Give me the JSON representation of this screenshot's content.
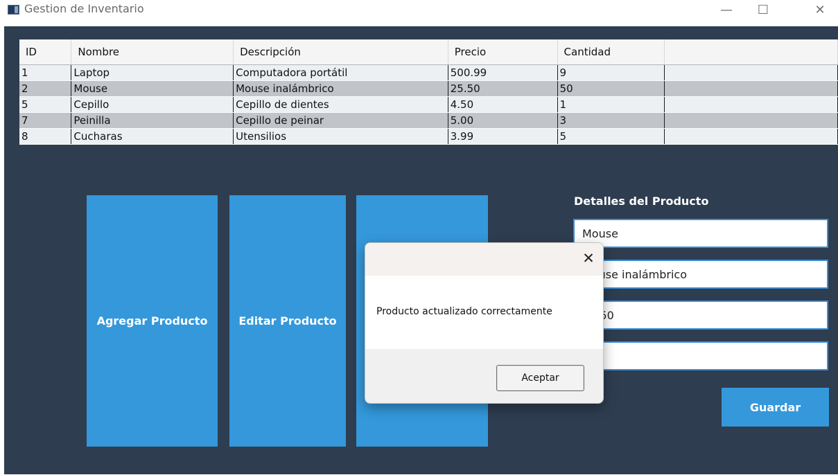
{
  "window": {
    "title": "Gestion de Inventario"
  },
  "controls": {
    "minimize": "—",
    "maximize": "☐",
    "close": "✕"
  },
  "table": {
    "columns": [
      "ID",
      "Nombre",
      "Descripción",
      "Precio",
      "Cantidad"
    ],
    "rows": [
      [
        "1",
        "Laptop",
        "Computadora portátil",
        "500.99",
        "9"
      ],
      [
        "2",
        "Mouse",
        "Mouse inalámbrico",
        "25.50",
        "50"
      ],
      [
        "5",
        "Cepillo",
        "Cepillo de dientes",
        "4.50",
        "1"
      ],
      [
        "7",
        "Peinilla",
        "Cepillo de peinar",
        "5.00",
        "3"
      ],
      [
        "8",
        "Cucharas",
        "Utensilios",
        "3.99",
        "5"
      ]
    ]
  },
  "actions": {
    "add_label": "Agregar Producto",
    "edit_label": "Editar Producto",
    "third_label": ""
  },
  "details": {
    "title": "Detalles del Producto",
    "name": "Mouse",
    "description": "Mouse inalámbrico",
    "price": "25.50",
    "quantity": "",
    "save_label": "Guardar"
  },
  "dialog": {
    "close_glyph": "✕",
    "message": "Producto actualizado correctamente",
    "ok_label": "Aceptar"
  },
  "colors": {
    "window_bg": "#2e3d50",
    "accent": "#3498db",
    "row_odd": "#edf0f2",
    "row_even": "#c1c5ca"
  }
}
